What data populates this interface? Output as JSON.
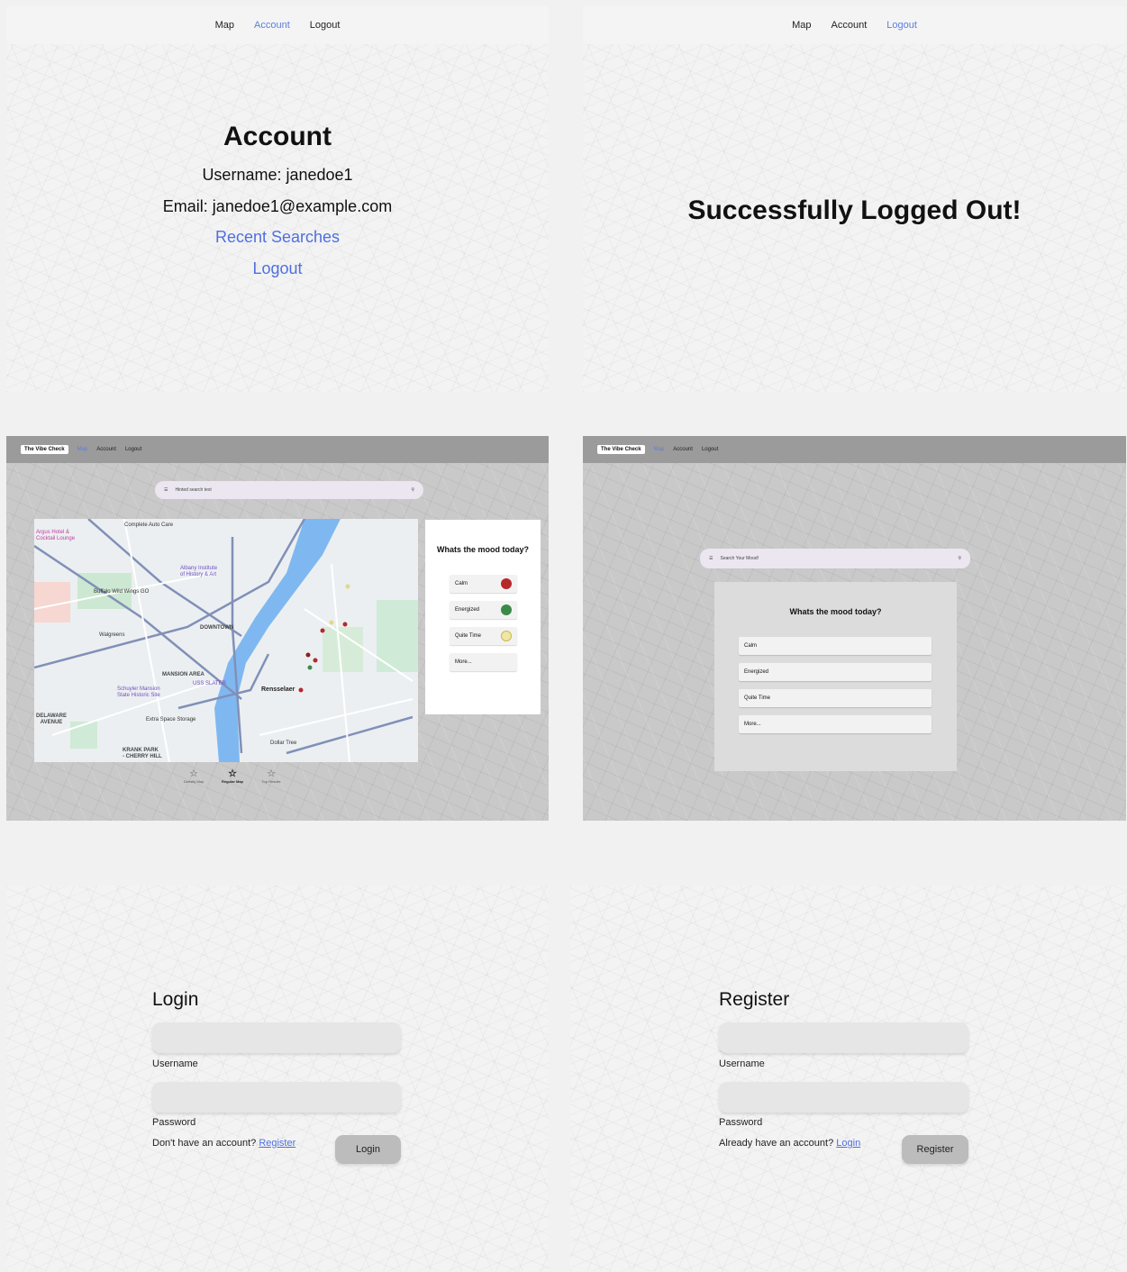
{
  "nav": {
    "map": "Map",
    "account": "Account",
    "logout": "Logout"
  },
  "account_page": {
    "title": "Account",
    "username": "Username: janedoe1",
    "email": "Email: janedoe1@example.com",
    "recent_searches": "Recent Searches",
    "logout_link": "Logout"
  },
  "logout_page": {
    "message": "Successfully Logged Out!"
  },
  "map_page": {
    "brand": "The Vibe Check",
    "search_placeholder": "Hinted search text",
    "mood_title": "Whats the mood today?",
    "moods": [
      {
        "label": "Calm",
        "color": "#b5282b"
      },
      {
        "label": "Energized",
        "color": "#3b8a4a"
      },
      {
        "label": "Quite Time",
        "color": "#f0e7a6"
      },
      {
        "label": "More..."
      }
    ],
    "map_labels": {
      "argus": "Argus Hotel &\nCocktail Lounge",
      "auto": "Complete Auto Care",
      "albany": "Albany Institute\nof History & Art",
      "wings": "Buffalo Wild Wings GO",
      "walgreens": "Walgreens",
      "downtown": "DOWNTOWN",
      "mansion": "MANSION AREA",
      "schuyler": "Schuyler Mansion\nState Historic Site",
      "uss": "USS SLATER",
      "rensselaer": "Rensselaer",
      "delaware": "DELAWARE\nAVENUE",
      "storage": "Extra Space Storage",
      "dollar": "Dollar Tree",
      "krank": "KRANK PARK\n- CHERRY HILL"
    },
    "bottom_tabs": [
      "Density Map",
      "Regular Map",
      "Top Results"
    ]
  },
  "mood_page": {
    "brand": "The Vibe Check",
    "search_placeholder": "Search Your Mood!",
    "mood_title": "Whats the mood today?",
    "moods": [
      "Calm",
      "Energized",
      "Quite Time",
      "More..."
    ]
  },
  "login_page": {
    "title": "Login",
    "username_label": "Username",
    "password_label": "Password",
    "prompt": "Don't have an account?",
    "prompt_link": "Register",
    "button": "Login"
  },
  "register_page": {
    "title": "Register",
    "username_label": "Username",
    "password_label": "Password",
    "prompt": "Already have an account?",
    "prompt_link": "Login",
    "button": "Register"
  }
}
